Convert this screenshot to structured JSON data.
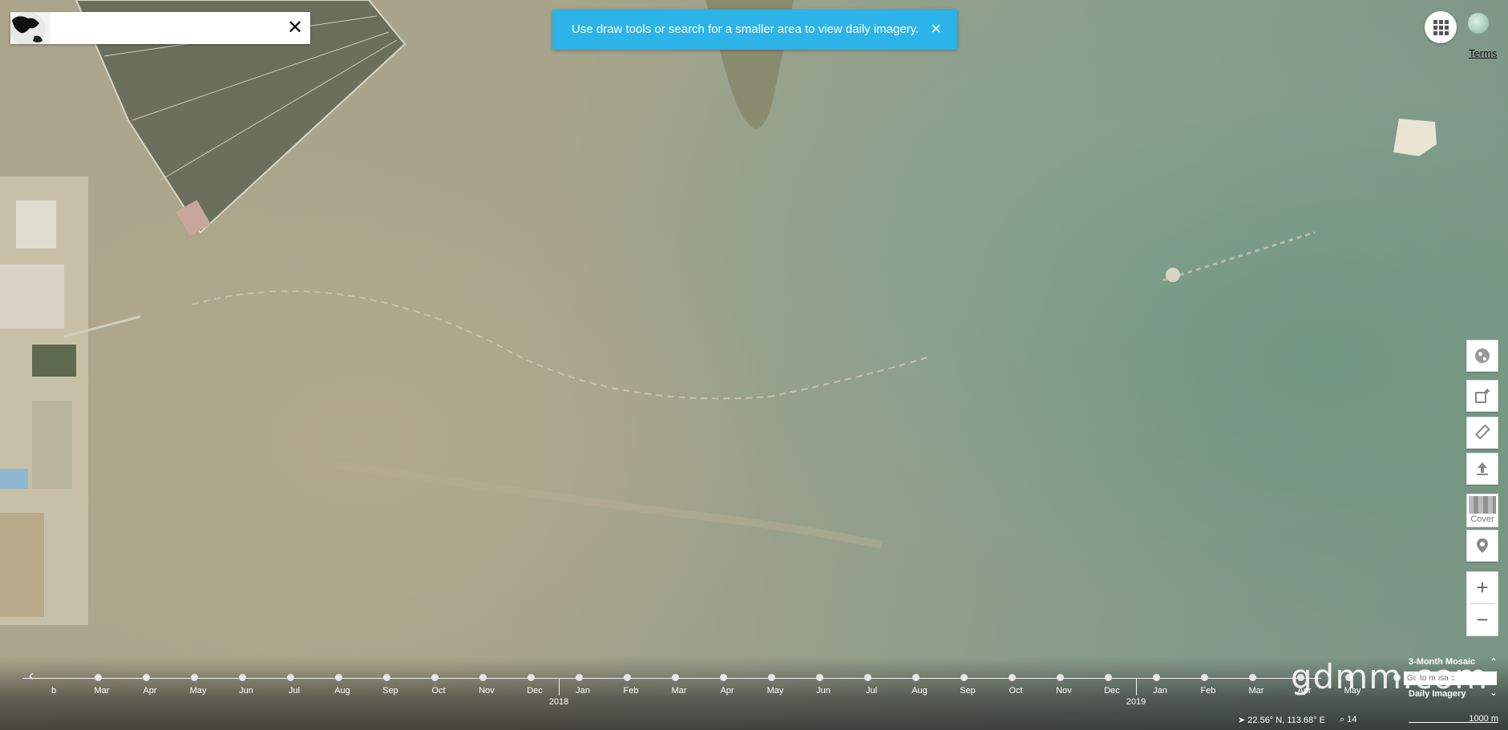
{
  "search": {
    "value": "",
    "placeholder": ""
  },
  "toast": {
    "message": "Use draw tools or search for a smaller area to view daily imagery.",
    "close": "×"
  },
  "header": {
    "terms": "Terms"
  },
  "tools": {
    "cover_label": "Cover",
    "zoom_in": "+",
    "zoom_out": "−"
  },
  "timeline": {
    "months": [
      "b",
      "Mar",
      "Apr",
      "May",
      "Jun",
      "Jul",
      "Aug",
      "Sep",
      "Oct",
      "Nov",
      "Dec",
      "Jan",
      "Feb",
      "Mar",
      "Apr",
      "May",
      "Jun",
      "Jul",
      "Aug",
      "Sep",
      "Oct",
      "Nov",
      "Dec",
      "Jan",
      "Feb",
      "Mar",
      "Apr",
      "May"
    ],
    "years": [
      "2018",
      "2019"
    ],
    "modes": {
      "mosaic": "3-Month Mosaic",
      "daily": "Daily Imagery",
      "input_placeholder": "Go to mosaic"
    }
  },
  "status": {
    "coordinates": "22.56° N, 113.68° E",
    "zoom": "14",
    "scale": "1000 m"
  },
  "watermark": "gdmm.com"
}
